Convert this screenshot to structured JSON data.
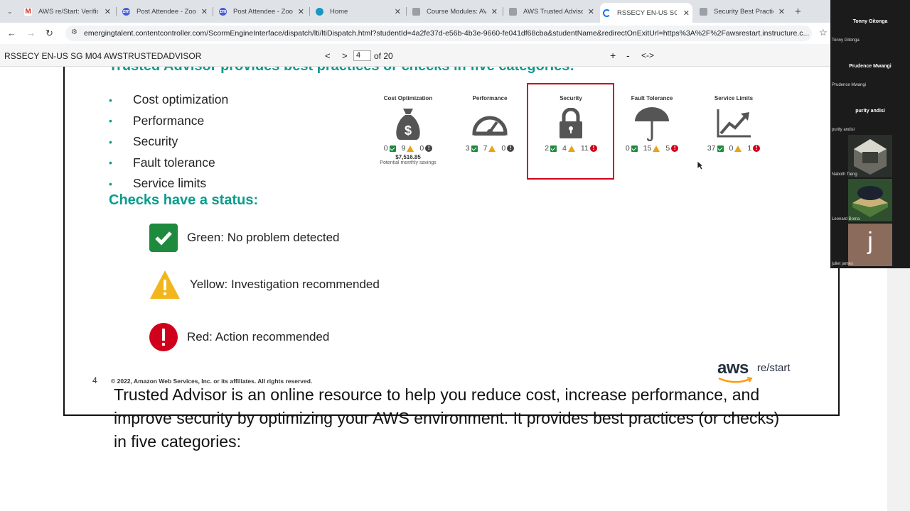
{
  "browser": {
    "tabs": [
      {
        "title": "AWS re/Start: Verific",
        "icon": "gmail-icon"
      },
      {
        "title": "Post Attendee - Zoo",
        "icon": "zoom-icon"
      },
      {
        "title": "Post Attendee - Zoo",
        "icon": "zoom-icon"
      },
      {
        "title": "Home",
        "icon": "salesforce-icon"
      },
      {
        "title": "Course Modules: AV",
        "icon": "canvas-icon"
      },
      {
        "title": "AWS Trusted Advisor",
        "icon": "canvas-icon"
      },
      {
        "title": "RSSECY EN-US SG M",
        "icon": "loading-icon",
        "active": true
      },
      {
        "title": "Security Best Practic",
        "icon": "canvas-icon"
      }
    ],
    "url": "emergingtalent.contentcontroller.com/ScormEngineInterface/dispatch/lti/ltiDispatch.html?studentId=4a2fe37d-e56b-4b3e-9660-fe041df68cba&studentName&redirectOnExitUrl=https%3A%2F%2Fawsrestart.instructure.c..."
  },
  "viewer": {
    "doc_title": "RSSECY EN-US SG M04 AWSTRUSTEDADVISOR",
    "page_input": "4",
    "page_total": "of 20",
    "prev": "<",
    "next": ">",
    "zoom_in": "+",
    "zoom_out": "-",
    "fit": "<->"
  },
  "slide": {
    "title": "Trusted Advisor provides best practices or checks in five categories:",
    "bullets": [
      "Cost optimization",
      "Performance",
      "Security",
      "Fault tolerance",
      "Service limits"
    ],
    "categories": [
      {
        "label": "Cost Optimization",
        "icon": "money-bag-icon",
        "green": "0",
        "yellow": "9",
        "red": "0",
        "red_style": "neutral",
        "savings": "$7,516.85",
        "savings_sub": "Potential monthly savings"
      },
      {
        "label": "Performance",
        "icon": "speedometer-icon",
        "green": "3",
        "yellow": "7",
        "red": "0",
        "red_style": "neutral"
      },
      {
        "label": "Security",
        "icon": "lock-icon",
        "green": "2",
        "yellow": "4",
        "red": "11",
        "red_style": "alert"
      },
      {
        "label": "Fault Tolerance",
        "icon": "umbrella-icon",
        "green": "0",
        "yellow": "15",
        "red": "5",
        "red_style": "alert"
      },
      {
        "label": "Service Limits",
        "icon": "trend-chart-icon",
        "green": "37",
        "yellow": "0",
        "red": "1",
        "red_style": "alert"
      }
    ],
    "status_heading": "Checks have a status:",
    "statuses": [
      {
        "label": "Green: No problem detected",
        "color": "#1d8a3e"
      },
      {
        "label": "Yellow: Investigation recommended",
        "color": "#f2b61c"
      },
      {
        "label": "Red: Action recommended",
        "color": "#d0021b"
      }
    ],
    "page_number": "4",
    "copyright": "© 2022, Amazon Web Services, Inc. or its affiliates. All rights reserved.",
    "logo_word": "aws",
    "logo_suffix": "re/start"
  },
  "notes": "Trusted Advisor is an online resource to help you reduce cost, increase performance, and improve security by optimizing your AWS environment. It provides best practices (or checks) in five categories:",
  "participants": [
    {
      "big": "Tonny Gitonga",
      "small": "Tonny Gitonga"
    },
    {
      "big": "Prudence Mwangi",
      "small": "Prudence Mwangi"
    },
    {
      "big": "purity andisi",
      "small": "purity andisi"
    },
    {
      "small": "Naboth Tieng"
    },
    {
      "small": "Leonard Boma"
    },
    {
      "small": "juliet james",
      "initial": "j"
    }
  ]
}
